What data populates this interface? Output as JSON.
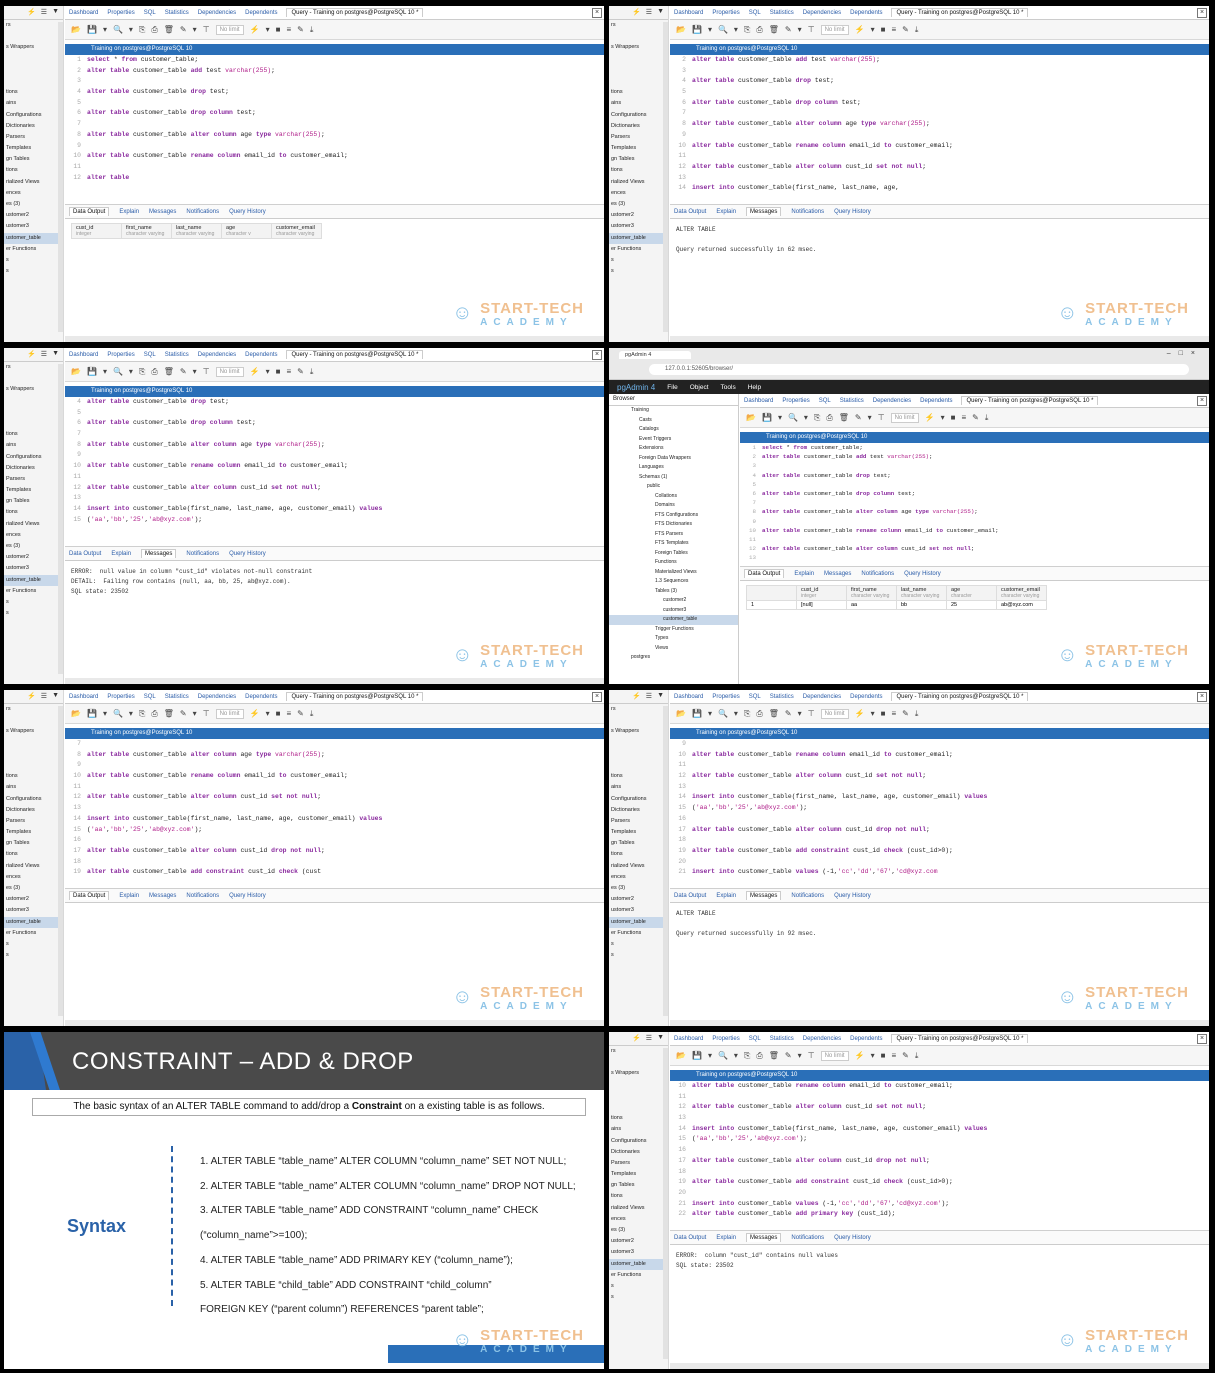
{
  "common": {
    "tabs": [
      "Dashboard",
      "Properties",
      "SQL",
      "Statistics",
      "Dependencies",
      "Dependents"
    ],
    "query_tab": "Query - Training on postgres@PostgreSQL 10 *",
    "connection": "Training on postgres@PostgreSQL 10",
    "no_limit": "No limit",
    "result_tabs": [
      "Data Output",
      "Explain",
      "Messages",
      "Notifications",
      "Query History"
    ],
    "logo_line1": "START-TECH",
    "logo_line2": "ACADEMY",
    "sidebar_items": [
      "rs",
      "",
      "s Wrappers",
      "",
      "",
      "",
      "tions",
      "ains",
      "Configurations",
      "Dictionaries",
      "Parsers",
      "Templates",
      "gn Tables",
      "tions",
      "rialized Views",
      "ences",
      "es (3)",
      "ustomer2",
      "ustomer3",
      "ustomer_table",
      "er Functions",
      "s",
      "s"
    ]
  },
  "panels": [
    {
      "lines": [
        [
          "1",
          "select * from customer_table;"
        ],
        [
          "2",
          "alter table customer_table add test varchar(255);"
        ],
        [
          "3",
          ""
        ],
        [
          "4",
          "alter table customer_table drop test;"
        ],
        [
          "5",
          ""
        ],
        [
          "6",
          "alter table customer_table drop column test;"
        ],
        [
          "7",
          ""
        ],
        [
          "8",
          "alter table customer_table alter column age type varchar(255);"
        ],
        [
          "9",
          ""
        ],
        [
          "10",
          "alter table customer_table rename column email_id to customer_email;"
        ],
        [
          "11",
          ""
        ],
        [
          "12",
          "alter table"
        ]
      ],
      "active_result": "Data Output",
      "table": {
        "headers": [
          [
            "cust_id",
            "integer"
          ],
          [
            "first_name",
            "character varying"
          ],
          [
            "last_name",
            "character varying"
          ],
          [
            "age",
            "character v"
          ],
          [
            "customer_email",
            "character varying"
          ]
        ]
      }
    },
    {
      "lines": [
        [
          "2",
          "alter table customer_table add test varchar(255);"
        ],
        [
          "3",
          ""
        ],
        [
          "4",
          "alter table customer_table drop test;"
        ],
        [
          "5",
          ""
        ],
        [
          "6",
          "alter table customer_table drop column test;"
        ],
        [
          "7",
          ""
        ],
        [
          "8",
          "alter table customer_table alter column age type varchar(255);"
        ],
        [
          "9",
          ""
        ],
        [
          "10",
          "alter table customer_table rename column email_id to customer_email;"
        ],
        [
          "11",
          ""
        ],
        [
          "12",
          "alter table customer_table alter column cust_id set not null;"
        ],
        [
          "13",
          ""
        ],
        [
          "14",
          "insert into customer_table(first_name, last_name, age,"
        ]
      ],
      "active_result": "Messages",
      "output": "ALTER TABLE\n\nQuery returned successfully in 62 msec."
    },
    {
      "lines": [
        [
          "4",
          "alter table customer_table drop test;"
        ],
        [
          "5",
          ""
        ],
        [
          "6",
          "alter table customer_table drop column test;"
        ],
        [
          "7",
          ""
        ],
        [
          "8",
          "alter table customer_table alter column age type varchar(255);"
        ],
        [
          "9",
          ""
        ],
        [
          "10",
          "alter table customer_table rename column email_id to customer_email;"
        ],
        [
          "11",
          ""
        ],
        [
          "12",
          "alter table customer_table alter column cust_id set not null;"
        ],
        [
          "13",
          ""
        ],
        [
          "14",
          "insert into customer_table(first_name, last_name, age, customer_email) values"
        ],
        [
          "15",
          "('aa','bb','25','ab@xyz.com');"
        ]
      ],
      "active_result": "Messages",
      "output": "ERROR:  null value in column \"cust_id\" violates not-null constraint\nDETAIL:  Failing row contains (null, aa, bb, 25, ab@xyz.com).\nSQL state: 23502"
    },
    {
      "browser_tab": "pgAdmin 4",
      "url": "127.0.0.1:52605/browser/",
      "menu": [
        "pgAdmin 4",
        "File",
        "Object",
        "Tools",
        "Help"
      ],
      "browser_label": "Browser",
      "tree": [
        "Training",
        "Casts",
        "Catalogs",
        "Event Triggers",
        "Extensions",
        "Foreign Data Wrappers",
        "Languages",
        "Schemas (1)",
        "public",
        "Collations",
        "Domains",
        "FTS Configurations",
        "FTS Dictionaries",
        "FTS Parsers",
        "FTS Templates",
        "Foreign Tables",
        "Functions",
        "Materialized Views",
        "1.3 Sequences",
        "Tables (3)",
        "customer2",
        "customer3",
        "customer_table",
        "Trigger Functions",
        "Types",
        "Views",
        "postgres"
      ],
      "lines": [
        [
          "1",
          "select * from customer_table;"
        ],
        [
          "2",
          "alter table customer_table add test varchar(255);"
        ],
        [
          "3",
          ""
        ],
        [
          "4",
          "alter table customer_table drop test;"
        ],
        [
          "5",
          ""
        ],
        [
          "6",
          "alter table customer_table drop column test;"
        ],
        [
          "7",
          ""
        ],
        [
          "8",
          "alter table customer_table alter column age type varchar(255);"
        ],
        [
          "9",
          ""
        ],
        [
          "10",
          "alter table customer_table rename column email_id to customer_email;"
        ],
        [
          "11",
          ""
        ],
        [
          "12",
          "alter table customer_table alter column cust_id set not null;"
        ],
        [
          "13",
          ""
        ]
      ],
      "active_result": "Data Output",
      "table": {
        "headers": [
          [
            "cust_id",
            "integer"
          ],
          [
            "first_name",
            "character varying"
          ],
          [
            "last_name",
            "character varying"
          ],
          [
            "age",
            "character"
          ],
          [
            "customer_email",
            "character varying"
          ]
        ],
        "row": [
          "1",
          "[null]",
          "aa",
          "bb",
          "25",
          "ab@xyz.com"
        ]
      }
    },
    {
      "lines": [
        [
          "7",
          ""
        ],
        [
          "8",
          "alter table customer_table alter column age type varchar(255);"
        ],
        [
          "9",
          ""
        ],
        [
          "10",
          "alter table customer_table rename column email_id to customer_email;"
        ],
        [
          "11",
          ""
        ],
        [
          "12",
          "alter table customer_table alter column cust_id set not null;"
        ],
        [
          "13",
          ""
        ],
        [
          "14",
          "insert into customer_table(first_name, last_name, age, customer_email) values"
        ],
        [
          "15",
          "('aa','bb','25','ab@xyz.com');"
        ],
        [
          "16",
          ""
        ],
        [
          "17",
          "alter table customer_table alter column cust_id drop not null;"
        ],
        [
          "18",
          ""
        ],
        [
          "19",
          "alter table customer_table add constraint cust_id check (cust"
        ]
      ],
      "active_result": "Data Output"
    },
    {
      "lines": [
        [
          "9",
          ""
        ],
        [
          "10",
          "alter table customer_table rename column email_id to customer_email;"
        ],
        [
          "11",
          ""
        ],
        [
          "12",
          "alter table customer_table alter column cust_id set not null;"
        ],
        [
          "13",
          ""
        ],
        [
          "14",
          "insert into customer_table(first_name, last_name, age, customer_email) values"
        ],
        [
          "15",
          "('aa','bb','25','ab@xyz.com');"
        ],
        [
          "16",
          ""
        ],
        [
          "17",
          "alter table customer_table alter column cust_id drop not null;"
        ],
        [
          "18",
          ""
        ],
        [
          "19",
          "alter table customer_table add constraint cust_id check (cust_id>0);"
        ],
        [
          "20",
          ""
        ],
        [
          "21",
          "insert into customer_table values (-1,'cc','dd','67','cd@xyz.com"
        ]
      ],
      "active_result": "Messages",
      "output": "ALTER TABLE\n\nQuery returned successfully in 92 msec."
    },
    {
      "title": "CONSTRAINT – ADD & DROP",
      "subtitle_pre": "The basic syntax of an ALTER TABLE command to add/drop a ",
      "subtitle_bold": "Constraint",
      "subtitle_post": " on a existing table is as follows.",
      "syntax_label": "Syntax",
      "items": [
        "1.   ALTER TABLE “table_name” ALTER COLUMN “column_name” SET NOT NULL;",
        "2.   ALTER TABLE “table_name” ALTER COLUMN “column_name” DROP NOT NULL;",
        "3.   ALTER TABLE “table_name” ADD CONSTRAINT “column_name” CHECK",
        "      (“column_name”>=100);",
        "4.   ALTER TABLE “table_name” ADD PRIMARY KEY (“column_name”);",
        "5.   ALTER TABLE “child_table” ADD CONSTRAINT “child_column”",
        "                FOREIGN KEY (“parent column”) REFERENCES “parent table”;"
      ]
    },
    {
      "lines": [
        [
          "10",
          "alter table customer_table rename column email_id to customer_email;"
        ],
        [
          "11",
          ""
        ],
        [
          "12",
          "alter table customer_table alter column cust_id set not null;"
        ],
        [
          "13",
          ""
        ],
        [
          "14",
          "insert into customer_table(first_name, last_name, age, customer_email) values"
        ],
        [
          "15",
          "('aa','bb','25','ab@xyz.com');"
        ],
        [
          "16",
          ""
        ],
        [
          "17",
          "alter table customer_table alter column cust_id drop not null;"
        ],
        [
          "18",
          ""
        ],
        [
          "19",
          "alter table customer_table add constraint cust_id check (cust_id>0);"
        ],
        [
          "20",
          ""
        ],
        [
          "21",
          "insert into customer_table values (-1,'cc','dd','67','cd@xyz.com');"
        ],
        [
          "22",
          "alter table customer_table add primary key (cust_id);"
        ]
      ],
      "active_result": "Messages",
      "output": "ERROR:  column \"cust_id\" contains null values\nSQL state: 23502"
    }
  ]
}
